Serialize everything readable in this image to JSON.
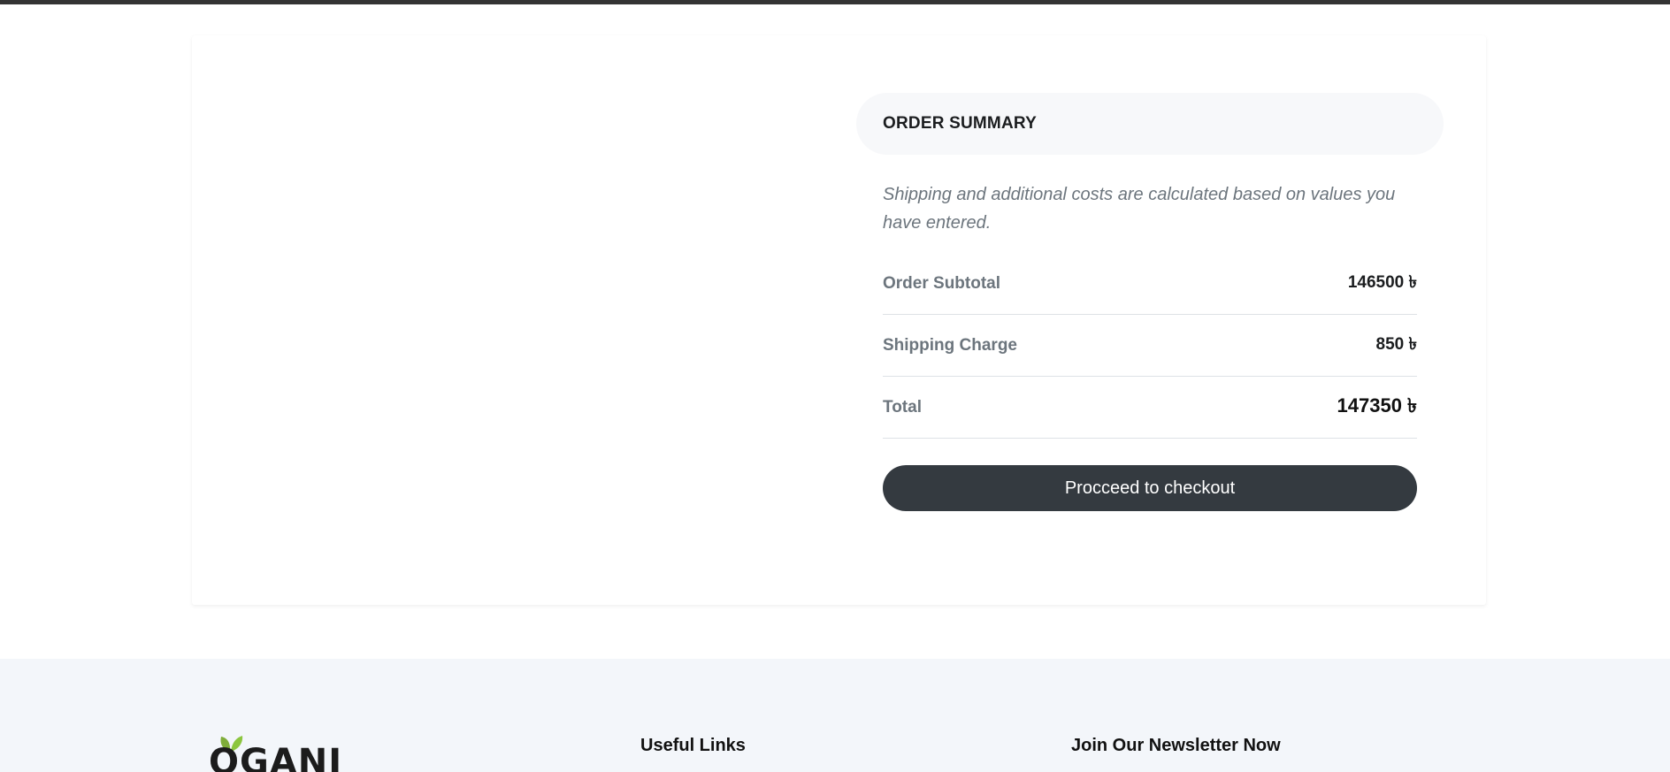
{
  "order_summary": {
    "title": "ORDER SUMMARY",
    "note": "Shipping and additional costs are calculated based on values you have entered.",
    "rows": [
      {
        "label": "Order Subtotal",
        "value": "146500 ৳"
      },
      {
        "label": "Shipping Charge",
        "value": "850 ৳"
      },
      {
        "label": "Total",
        "value": "147350 ৳"
      }
    ],
    "checkout_label": "Procceed to checkout"
  },
  "footer": {
    "logo_text": "OGANI",
    "useful_links_heading": "Useful Links",
    "newsletter_heading": "Join Our Newsletter Now"
  },
  "colors": {
    "button_bg": "#343a40",
    "footer_bg": "#f3f6fa",
    "leaf_green": "#7fad39"
  }
}
